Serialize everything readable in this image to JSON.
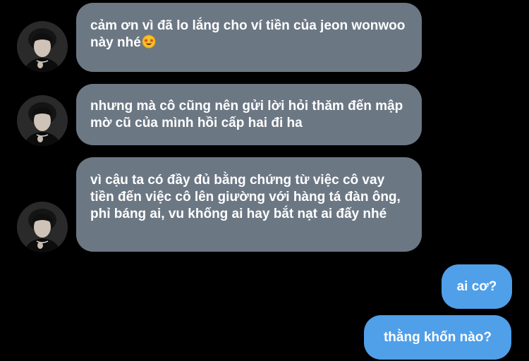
{
  "conversation": {
    "incoming": [
      {
        "text": "cảm ơn vì đã lo lắng cho ví tiền của jeon wonwoo này nhé",
        "emoji": "star-struck-emoji"
      },
      {
        "text": "nhưng mà cô cũng nên gửi lời hỏi thăm đến mập mờ cũ của mình hồi cấp hai đi ha"
      },
      {
        "text": "vì cậu ta có đầy đủ bằng chứng từ việc cô vay tiền đến việc cô lên giường với hàng tá đàn ông, phỉ báng ai, vu khống ai hay bắt nạt ai đấy nhé"
      }
    ],
    "outgoing": [
      {
        "text": "ai cơ?"
      },
      {
        "text": "thằng khốn nào?"
      }
    ]
  },
  "colors": {
    "background": "#000000",
    "incoming_bubble": "#6c7784",
    "outgoing_bubble": "#4f9fe9",
    "text": "#ffffff"
  }
}
